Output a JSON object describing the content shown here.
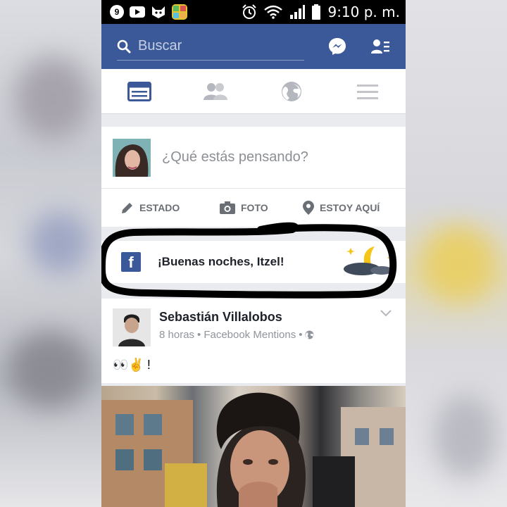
{
  "status_bar": {
    "time": "9:10 p. m."
  },
  "search": {
    "placeholder": "Buscar"
  },
  "composer": {
    "prompt": "¿Qué estás pensando?",
    "actions": [
      {
        "label": "ESTADO",
        "icon": "pencil-icon"
      },
      {
        "label": "FOTO",
        "icon": "camera-icon"
      },
      {
        "label": "ESTOY AQUÍ",
        "icon": "location-pin-icon"
      }
    ]
  },
  "greeting": {
    "text": "¡Buenas noches, Itzel!"
  },
  "post": {
    "author": "Sebastián Villalobos",
    "time": "8 horas",
    "source": "Facebook Mentions",
    "separator": "•",
    "body": "!",
    "body_emojis": "👀✌"
  },
  "colors": {
    "facebook_blue": "#3b5998",
    "status_bar": "#000000",
    "feed_bg": "#e9ebee",
    "marker": "#000000"
  }
}
